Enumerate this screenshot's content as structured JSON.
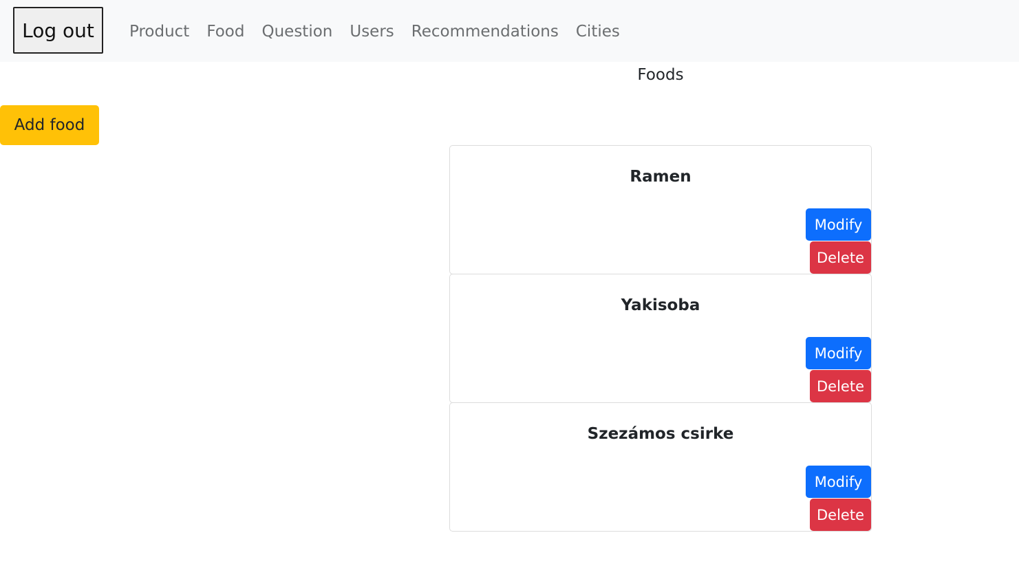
{
  "navbar": {
    "logout_label": "Log out",
    "links": [
      {
        "label": "Product"
      },
      {
        "label": "Food"
      },
      {
        "label": "Question"
      },
      {
        "label": "Users"
      },
      {
        "label": "Recommendations"
      },
      {
        "label": "Cities"
      }
    ]
  },
  "main": {
    "title": "Foods",
    "add_label": "Add food",
    "foods": [
      {
        "name": "Ramen",
        "modify_label": "Modify",
        "delete_label": "Delete"
      },
      {
        "name": "Yakisoba",
        "modify_label": "Modify",
        "delete_label": "Delete"
      },
      {
        "name": "Szezámos csirke",
        "modify_label": "Modify",
        "delete_label": "Delete"
      }
    ]
  },
  "colors": {
    "navbar_bg": "#f8f9fa",
    "warning": "#ffc107",
    "primary": "#0d6efd",
    "danger": "#dc3545"
  }
}
